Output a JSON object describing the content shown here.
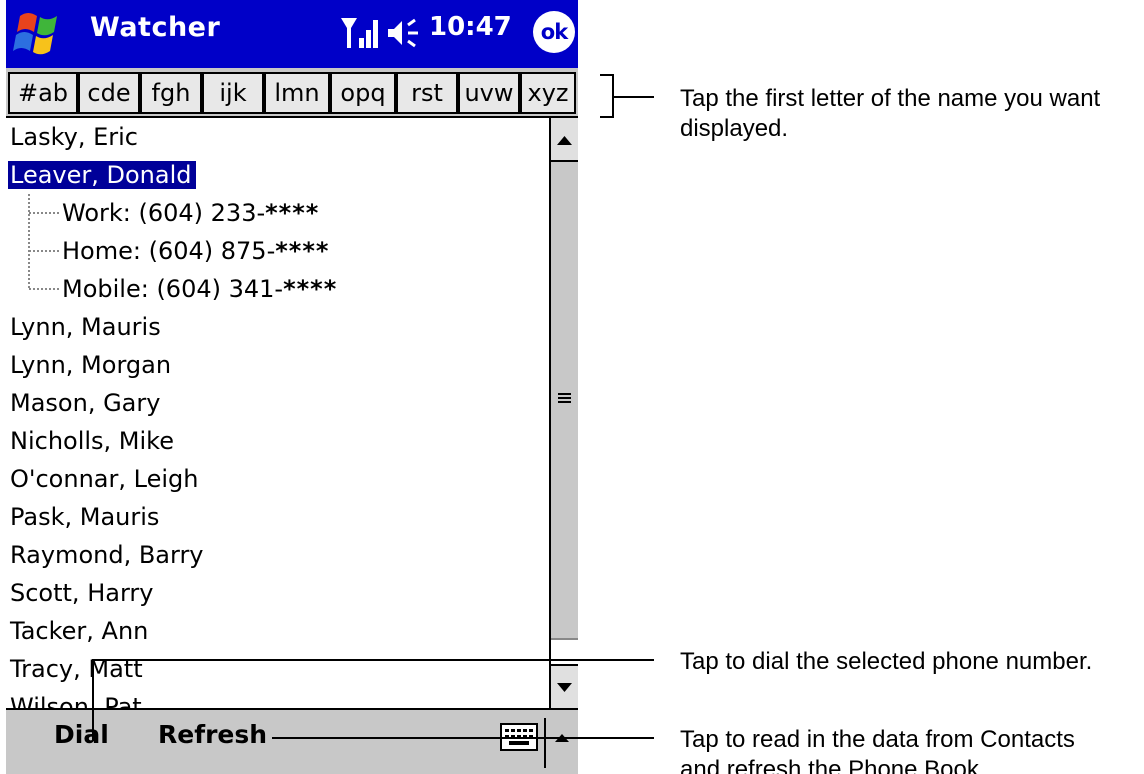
{
  "app": {
    "title": "Watcher",
    "time": "10:47",
    "ok_label": "ok"
  },
  "icons": {
    "start": "windows-flag-icon",
    "signal": "signal-strength-icon",
    "volume": "speaker-icon",
    "keyboard": "keyboard-icon",
    "scroll_up": "up-arrow-icon",
    "scroll_down": "down-arrow-icon",
    "sip": "up-arrow-icon"
  },
  "colors": {
    "titlebar": "#0000c8",
    "selection": "#000099",
    "chrome": "#c8c8c8"
  },
  "letter_tabs": [
    "#ab",
    "cde",
    "fgh",
    "ijk",
    "lmn",
    "opq",
    "rst",
    "uvw",
    "xyz"
  ],
  "contacts": [
    {
      "name": "Lasky, Eric"
    },
    {
      "name": "Leaver, Donald",
      "selected": true
    },
    {
      "name": "Lynn, Mauris"
    },
    {
      "name": "Lynn, Morgan"
    },
    {
      "name": "Mason, Gary"
    },
    {
      "name": "Nicholls, Mike"
    },
    {
      "name": "O'connar, Leigh"
    },
    {
      "name": "Pask, Mauris"
    },
    {
      "name": "Raymond, Barry"
    },
    {
      "name": "Scott, Harry"
    },
    {
      "name": "Tacker, Ann"
    },
    {
      "name": "Tracy, Matt"
    },
    {
      "name": "Wilson, Pat"
    }
  ],
  "selected_numbers": [
    {
      "label": "Work: (604) 233-",
      "mask": "****"
    },
    {
      "label": "Home: (604) 875-",
      "mask": "****"
    },
    {
      "label": "Mobile: (604) 341-",
      "mask": "****"
    }
  ],
  "menu": {
    "dial": "Dial",
    "refresh": "Refresh"
  },
  "callouts": {
    "letters": "Tap the first letter of the name you want displayed.",
    "dial": "Tap to dial the selected phone number.",
    "refresh": "Tap to read in the data from Contacts and refresh the Phone Book."
  }
}
